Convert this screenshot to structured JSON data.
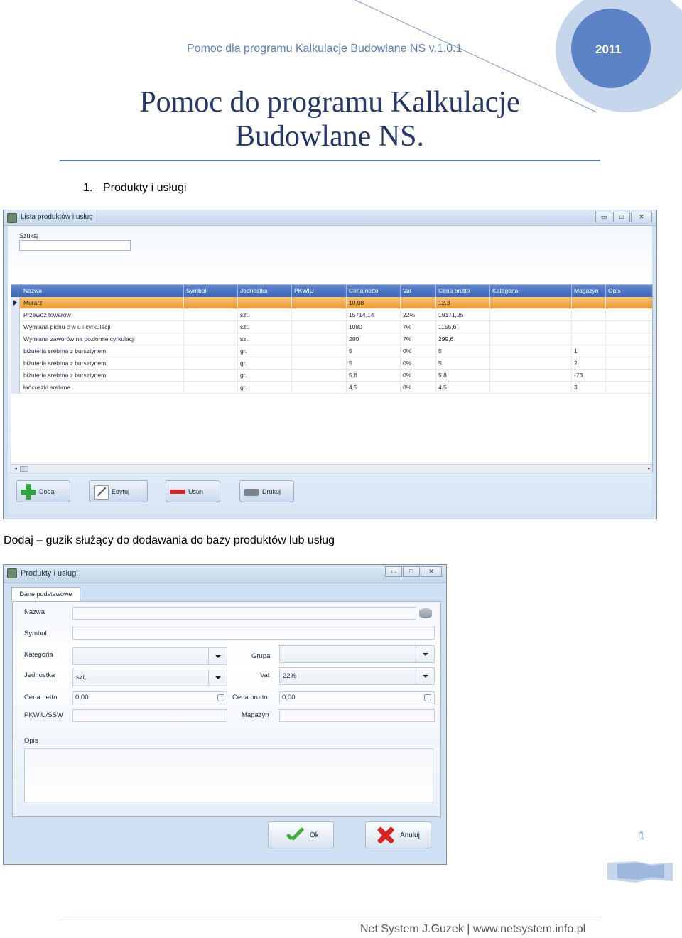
{
  "header": {
    "running_title": "Pomoc dla programu Kalkulacje Budowlane NS v.1.0.1",
    "year": "2011",
    "title_line1": "Pomoc do programu Kalkulacje",
    "title_line2": "Budowlane NS.",
    "section_number": "1.",
    "section_title": "Produkty i usługi"
  },
  "list_window": {
    "title": "Lista produktów i usług",
    "controls": [
      "▭",
      "□",
      "✕"
    ],
    "search_label": "Szukaj",
    "search_value": "",
    "columns": [
      "Nazwa",
      "Symbol",
      "Jednostka",
      "PKWIU",
      "Cena netto",
      "Vat",
      "Cena brutto",
      "Kategoria",
      "Magazyn",
      "Opis"
    ],
    "rows": [
      [
        "Murarz",
        "",
        "",
        "",
        "10,08",
        "",
        "12,3",
        "",
        "",
        ""
      ],
      [
        "Przewóz towarów",
        "",
        "szt.",
        "",
        "15714,14",
        "22%",
        "19171,25",
        "",
        "",
        ""
      ],
      [
        "Wymiana pionu c w u i cyrkulacji",
        "",
        "szt.",
        "",
        "1080",
        "7%",
        "1155,6",
        "",
        "",
        ""
      ],
      [
        "Wymiana zaworów na poziomie cyrkulacji",
        "",
        "szt.",
        "",
        "280",
        "7%",
        "299,6",
        "",
        "",
        ""
      ],
      [
        "biżuteria srebrna z bursztynem",
        "",
        "gr.",
        "",
        "5",
        "0%",
        "5",
        "",
        "1",
        ""
      ],
      [
        "biżuteria srebrna z bursztynem",
        "",
        "gr.",
        "",
        "5",
        "0%",
        "5",
        "",
        "2",
        ""
      ],
      [
        "biżuteria srebrna z bursztynem",
        "",
        "gr.",
        "",
        "5,8",
        "0%",
        "5,8",
        "",
        "-73",
        ""
      ],
      [
        "łańcuszki srebrne",
        "",
        "gr.",
        "",
        "4,5",
        "0%",
        "4,5",
        "",
        "3",
        ""
      ]
    ],
    "selected_row": 0,
    "buttons": {
      "add": "Dodaj",
      "edit": "Edytuj",
      "delete": "Usun",
      "print": "Drukuj"
    }
  },
  "caption": "Dodaj – guzik służący do dodawania do bazy produktów lub usług",
  "form_window": {
    "title": "Produkty i usługi",
    "controls": [
      "▭",
      "□",
      "✕"
    ],
    "tab": "Dane podstawowe",
    "fields": {
      "name_label": "Nazwa",
      "name_value": "",
      "symbol_label": "Symbol",
      "symbol_value": "",
      "category_label": "Kategoria",
      "category_value": "",
      "group_label": "Grupa",
      "group_value": "",
      "unit_label": "Jednostka",
      "unit_value": "szt.",
      "vat_label": "Vat",
      "vat_value": "22%",
      "net_price_label": "Cena netto",
      "net_price_value": "0,00",
      "gross_price_label": "Cena brutto",
      "gross_price_value": "0,00",
      "pkwiu_label": "PKWiU/SSW",
      "pkwiu_value": "",
      "warehouse_label": "Magazyn",
      "warehouse_value": "",
      "description_label": "Opis",
      "description_value": ""
    },
    "buttons": {
      "ok": "Ok",
      "cancel": "Anuluj"
    }
  },
  "footer": {
    "page_number": "1",
    "text": "Net System J.Guzek | www.netsystem.info.pl"
  },
  "colors": {
    "accent": "#5b82c4",
    "title": "#23376b",
    "grid_header": "#4a74c0",
    "selection": "#f0a63f"
  }
}
